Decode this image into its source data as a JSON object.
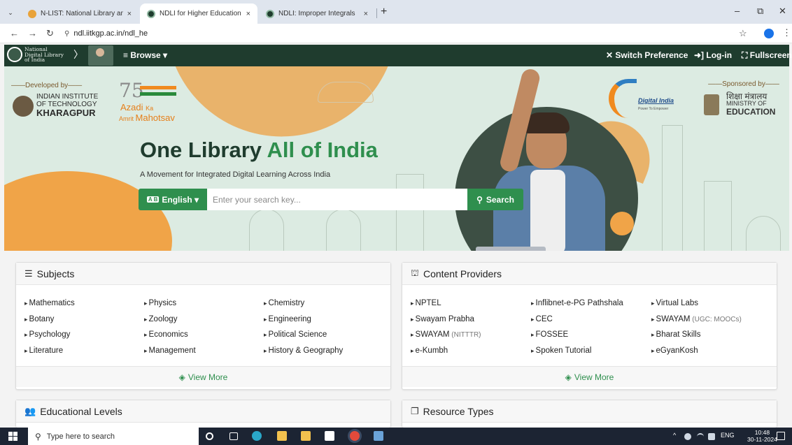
{
  "browser": {
    "tabs": [
      {
        "title": "N-LIST: National Library and Inf",
        "active": false
      },
      {
        "title": "NDLI for Higher Education",
        "active": true
      },
      {
        "title": "NDLI: Improper Integrals",
        "active": false
      }
    ],
    "close_glyph": "×",
    "new_tab_glyph": "+",
    "tab_menu_glyph": "⌄",
    "url": "ndl.iitkgp.ac.in/ndl_he",
    "window_controls": {
      "minimize": "–",
      "maximize": "⧉",
      "close": "✕"
    },
    "nav_glyphs": {
      "back": "←",
      "forward": "→",
      "reload": "↻",
      "site_settings": "⚲",
      "star": "☆",
      "menu": "⋮"
    }
  },
  "navbar": {
    "logo_lines": [
      "National",
      "Digital Library",
      "of India"
    ],
    "chevron": "〉",
    "browse_label": "≡ Browse ▾",
    "switch_preference": "✕ Switch Preference",
    "login": "➜] Log-in",
    "fullscreen": "⛶ Fullscreen"
  },
  "hero": {
    "developed_by": "——Developed by——",
    "iit_lines": [
      "INDIAN INSTITUTE",
      "OF TECHNOLOGY",
      "KHARAGPUR"
    ],
    "azadi": {
      "number": "75",
      "azadi": "Azadi",
      "ka": "Ka",
      "amrit": "Amrit",
      "mahotsav": "Mahotsav"
    },
    "digital_india": {
      "title": "Digital India",
      "subtitle": "Power To Empower"
    },
    "sponsored_by": "——Sponsored by——",
    "ministry": {
      "hindi": "शिक्षा मंत्रालय",
      "line1": "MINISTRY OF",
      "line2": "EDUCATION"
    },
    "title_part1": "One Library ",
    "title_part2": "All of India",
    "subtitle": "A Movement for Integrated Digital Learning Across India",
    "language_button": "English ▾",
    "language_badge": "A B",
    "search_placeholder": "Enter your search key...",
    "search_button": "Search",
    "search_icon": "⚲"
  },
  "subjects": {
    "title": "Subjects",
    "icon": "☰",
    "columns": [
      [
        "Mathematics",
        "Botany",
        "Psychology",
        "Literature"
      ],
      [
        "Physics",
        "Zoology",
        "Economics",
        "Management"
      ],
      [
        "Chemistry",
        "Engineering",
        "Political Science",
        "History & Geography"
      ]
    ],
    "view_more": "View More",
    "view_more_icon": "◈"
  },
  "providers": {
    "title": "Content Providers",
    "icon": "⛫",
    "columns": [
      [
        {
          "main": "NPTEL",
          "extra": ""
        },
        {
          "main": "Swayam Prabha",
          "extra": ""
        },
        {
          "main": "SWAYAM",
          "extra": " (NITTTR)"
        },
        {
          "main": "e-Kumbh",
          "extra": ""
        }
      ],
      [
        {
          "main": "Inflibnet-e-PG Pathshala",
          "extra": ""
        },
        {
          "main": "CEC",
          "extra": ""
        },
        {
          "main": "FOSSEE",
          "extra": ""
        },
        {
          "main": "Spoken Tutorial",
          "extra": ""
        }
      ],
      [
        {
          "main": "Virtual Labs",
          "extra": ""
        },
        {
          "main": "SWAYAM",
          "extra": " (UGC: MOOCs)"
        },
        {
          "main": "Bharat Skills",
          "extra": ""
        },
        {
          "main": "eGyanKosh",
          "extra": ""
        }
      ]
    ],
    "view_more": "View More",
    "view_more_icon": "◈"
  },
  "educational_levels": {
    "title": "Educational Levels",
    "icon": "👥"
  },
  "resource_types": {
    "title": "Resource Types",
    "icon": "❐"
  },
  "taskbar": {
    "search_placeholder": "Type here to search",
    "search_icon": "⚲",
    "tray": "^",
    "language": "ENG",
    "time": "10:48",
    "date": "30-11-2024"
  }
}
